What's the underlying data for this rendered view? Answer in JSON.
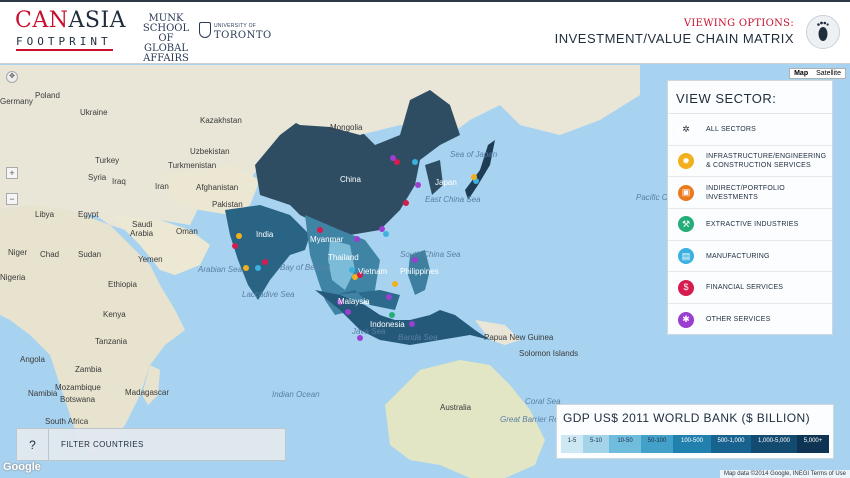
{
  "header": {
    "logo_can": "CAN",
    "logo_asia": "ASIA",
    "logo_footprint": "FOOTPRINT",
    "munk": [
      "MUNK",
      "SCHOOL",
      "OF",
      "GLOBAL",
      "AFFAIRS"
    ],
    "uoft_small": "UNIVERSITY OF",
    "uoft_big": "TORONTO",
    "viewing_label": "VIEWING OPTIONS:",
    "viewing_value": "INVESTMENT/VALUE CHAIN MATRIX",
    "footprint_icon": "footprint-icon"
  },
  "map": {
    "map_type_options": [
      "Map",
      "Satellite"
    ],
    "active_map_type": "Map",
    "labels": {
      "germany": "Germany",
      "poland": "Poland",
      "ukraine": "Ukraine",
      "kazakhstan": "Kazakhstan",
      "mongolia": "Mongolia",
      "russia_n": "Uzbekistan",
      "turkey": "Turkey",
      "turkmenistan": "Turkmenistan",
      "syria": "Syria",
      "iraq": "Iraq",
      "iran": "Iran",
      "afghanistan": "Afghanistan",
      "pakistan": "Pakistan",
      "libya": "Libya",
      "egypt": "Egypt",
      "saudi": "Saudi",
      "arabia": "Arabia",
      "oman": "Oman",
      "yemen": "Yemen",
      "niger": "Niger",
      "chad": "Chad",
      "sudan": "Sudan",
      "nigeria": "Nigeria",
      "ethiopia": "Ethiopia",
      "kenya": "Kenya",
      "tanzania": "Tanzania",
      "angola": "Angola",
      "zambia": "Zambia",
      "namibia": "Namibia",
      "botswana": "Botswana",
      "madagascar": "Madagascar",
      "mozambique": "Mozambique",
      "south_africa": "South Africa",
      "china": "China",
      "india": "India",
      "japan": "Japan",
      "myanmar": "Myanmar",
      "thailand": "Thailand",
      "vietnam": "Vietnam",
      "philippines": "Philippines",
      "malaysia": "Malaysia",
      "indonesia": "Indonesia",
      "papua": "Papua New Guinea",
      "solomon": "Solomon Islands",
      "australia": "Australia",
      "arabian_sea": "Arabian Sea",
      "bay_of_bengal": "Bay of Bengal",
      "laccadive": "Laccadive Sea",
      "indian_ocean": "Indian Ocean",
      "south_china_sea": "South China Sea",
      "east_china_sea": "East China Sea",
      "sea_of_japan": "Sea of Japan",
      "banda_sea": "Banda Sea",
      "java_sea": "Java Sea",
      "pacific_ocean": "Pacific Ocean",
      "coral_sea": "Coral Sea",
      "great_barrier": "Great Barrier Reef"
    }
  },
  "sector_panel": {
    "title": "VIEW SECTOR:",
    "items": [
      {
        "label": "ALL SECTORS",
        "icon": "all-sectors-icon",
        "color": "#ffffff",
        "glyph": "✲"
      },
      {
        "label": "INFRASTRUCTURE/ENGINEERING & CONSTRUCTION SERVICES",
        "icon": "gear-icon",
        "color": "#f2b01e",
        "glyph": "✹"
      },
      {
        "label": "INDIRECT/PORTFOLIO INVESTMENTS",
        "icon": "briefcase-icon",
        "color": "#ea7a1c",
        "glyph": "▣"
      },
      {
        "label": "EXTRACTIVE INDUSTRIES",
        "icon": "pickaxe-icon",
        "color": "#25ad78",
        "glyph": "⚒"
      },
      {
        "label": "MANUFACTURING",
        "icon": "factory-icon",
        "color": "#3ab1df",
        "glyph": "▤"
      },
      {
        "label": "FINANCIAL SERVICES",
        "icon": "dollar-icon",
        "color": "#d81b4e",
        "glyph": "$"
      },
      {
        "label": "OTHER SERVICES",
        "icon": "asterisk-icon",
        "color": "#9b3fd1",
        "glyph": "✱"
      }
    ]
  },
  "legend": {
    "title": "GDP US$ 2011 WORLD BANK ($ BILLION)",
    "scale": [
      {
        "label": "1-5",
        "color": "#cde7f3",
        "text": "#1f2d3d"
      },
      {
        "label": "5-10",
        "color": "#a3d4e9",
        "text": "#1f2d3d"
      },
      {
        "label": "10-50",
        "color": "#6fbcdd",
        "text": "#1f2d3d"
      },
      {
        "label": "50-100",
        "color": "#42a0c9",
        "text": "#1f2d3d"
      },
      {
        "label": "100-500",
        "color": "#2280ae",
        "text": "#ffffff"
      },
      {
        "label": "500-1,000",
        "color": "#18628f",
        "text": "#ffffff"
      },
      {
        "label": "1,000-5,000",
        "color": "#134a70",
        "text": "#ffffff"
      },
      {
        "label": "5,000+",
        "color": "#0e3353",
        "text": "#ffffff"
      }
    ]
  },
  "filter": {
    "help": "?",
    "label": "FILTER COUNTRIES"
  },
  "footer": {
    "google": "Google",
    "attribution": "Map data ©2014 Google, INEGI   Terms of Use"
  }
}
